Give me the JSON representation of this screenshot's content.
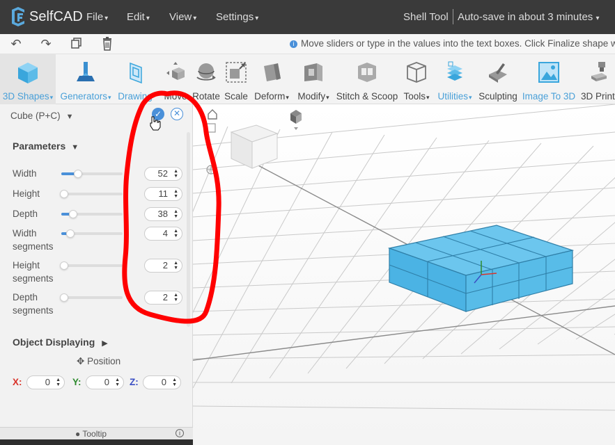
{
  "app": {
    "name": "SelfCAD",
    "menus": [
      "File",
      "Edit",
      "View",
      "Settings"
    ],
    "tool_name": "Shell Tool",
    "autosave": "Auto-save in about 3 minutes"
  },
  "hint": "Move sliders or type in the values into the text boxes. Click Finalize shape w",
  "toolbar": [
    {
      "label": "3D Shapes",
      "caret": true,
      "blue": true
    },
    {
      "label": "Generators",
      "caret": true,
      "blue": true
    },
    {
      "label": "Drawing",
      "caret": false,
      "blue": true
    },
    {
      "label": "Move",
      "caret": false,
      "blue": false
    },
    {
      "label": "Rotate",
      "caret": false,
      "blue": false
    },
    {
      "label": "Scale",
      "caret": false,
      "blue": false
    },
    {
      "label": "Deform",
      "caret": true,
      "blue": false
    },
    {
      "label": "Modify",
      "caret": true,
      "blue": false
    },
    {
      "label": "Stitch & Scoop",
      "caret": false,
      "blue": false
    },
    {
      "label": "Tools",
      "caret": true,
      "blue": false
    },
    {
      "label": "Utilities",
      "caret": true,
      "blue": true
    },
    {
      "label": "Sculpting",
      "caret": false,
      "blue": false
    },
    {
      "label": "Image To 3D",
      "caret": false,
      "blue": true
    },
    {
      "label": "3D Print",
      "caret": false,
      "blue": false
    }
  ],
  "panel": {
    "shape_name": "Cube (P+C)",
    "parameters_title": "Parameters",
    "params": [
      {
        "label": "Width",
        "value": "52",
        "fraction": 0.27
      },
      {
        "label": "Height",
        "value": "11",
        "fraction": 0.05
      },
      {
        "label": "Depth",
        "value": "38",
        "fraction": 0.19
      },
      {
        "label": "Width\nsegments",
        "value": "4",
        "fraction": 0.15
      },
      {
        "label": "Height\nsegments",
        "value": "2",
        "fraction": 0.05
      },
      {
        "label": "Depth\nsegments",
        "value": "2",
        "fraction": 0.05
      }
    ],
    "object_displaying_title": "Object Displaying",
    "position_title": "Position",
    "coords": [
      {
        "label": "X:",
        "value": "0",
        "color": "#d9342b"
      },
      {
        "label": "Y:",
        "value": "0",
        "color": "#2e8b2e"
      },
      {
        "label": "Z:",
        "value": "0",
        "color": "#3b4fc4"
      }
    ],
    "tooltip_label": "Tooltip"
  },
  "colors": {
    "accent": "#4a90d9",
    "shape_fill": "#4fb8e6",
    "annotation": "#ff0000"
  }
}
